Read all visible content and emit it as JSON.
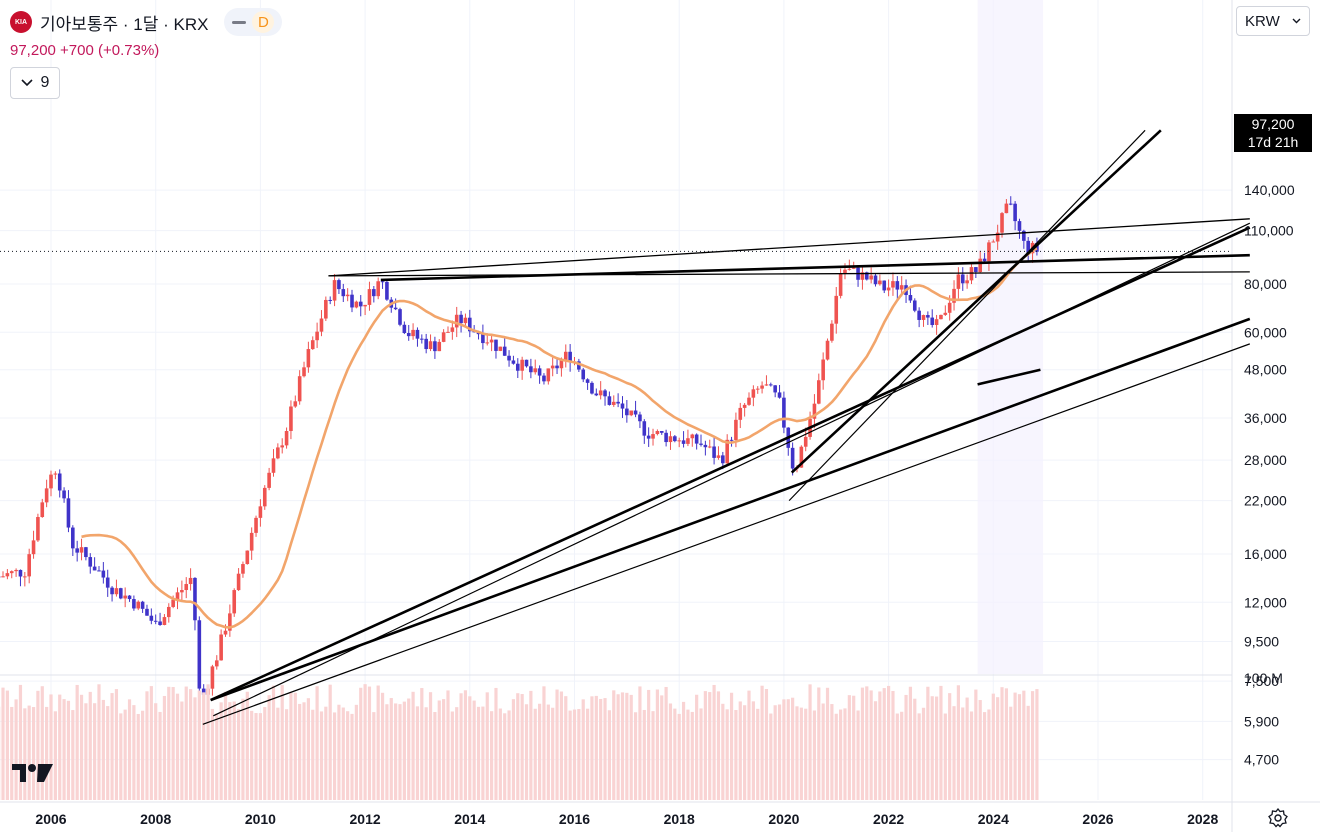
{
  "header": {
    "logo_text": "KIA",
    "symbol": "기아보통주 · 1달 · KRX",
    "quote": "97,200 +700 (+0.73%)",
    "collapse_count": "9",
    "currency": "KRW"
  },
  "price_tag": {
    "price": "97,200",
    "countdown": "17d 21h"
  },
  "colors": {
    "up": "#ef5350",
    "down": "#3f33c9",
    "ma": "#f2a56b",
    "volume": "#f9d3d3",
    "trendline": "#000000"
  },
  "icons": [
    "chevron-down-icon",
    "tradingview-logo-icon",
    "settings-icon"
  ],
  "chart_data": {
    "type": "candlestick",
    "title": "기아보통주 · 1달 · KRX",
    "scale": "log",
    "y_ticks": [
      "140,000",
      "110,000",
      "80,000",
      "60,000",
      "48,000",
      "36,000",
      "28,000",
      "22,000",
      "16,000",
      "12,000",
      "9,500",
      "7,500",
      "5,900",
      "4,700"
    ],
    "y_tick_values": [
      140000,
      110000,
      80000,
      60000,
      48000,
      36000,
      28000,
      22000,
      16000,
      12000,
      9500,
      7500,
      5900,
      4700
    ],
    "x_ticks": [
      "2006",
      "2008",
      "2010",
      "2012",
      "2014",
      "2016",
      "2018",
      "2020",
      "2022",
      "2024",
      "2026",
      "2028"
    ],
    "volume_label": "100 M",
    "last_price": 97200,
    "moving_average": "orange line",
    "series": [
      {
        "t": 2005.0,
        "p": 14000
      },
      {
        "t": 2005.5,
        "p": 14500
      },
      {
        "t": 2005.9,
        "p": 24000
      },
      {
        "t": 2006.1,
        "p": 27000
      },
      {
        "t": 2006.4,
        "p": 17000
      },
      {
        "t": 2006.8,
        "p": 15000
      },
      {
        "t": 2007.2,
        "p": 13000
      },
      {
        "t": 2007.6,
        "p": 12000
      },
      {
        "t": 2008.0,
        "p": 10500
      },
      {
        "t": 2008.3,
        "p": 12000
      },
      {
        "t": 2008.7,
        "p": 14000
      },
      {
        "t": 2008.85,
        "p": 6500
      },
      {
        "t": 2009.2,
        "p": 9000
      },
      {
        "t": 2009.6,
        "p": 14000
      },
      {
        "t": 2010.0,
        "p": 22000
      },
      {
        "t": 2010.5,
        "p": 34000
      },
      {
        "t": 2010.9,
        "p": 52000
      },
      {
        "t": 2011.4,
        "p": 80000
      },
      {
        "t": 2011.9,
        "p": 70000
      },
      {
        "t": 2012.3,
        "p": 82000
      },
      {
        "t": 2012.8,
        "p": 60000
      },
      {
        "t": 2013.3,
        "p": 55000
      },
      {
        "t": 2013.8,
        "p": 65000
      },
      {
        "t": 2014.4,
        "p": 57000
      },
      {
        "t": 2014.9,
        "p": 50000
      },
      {
        "t": 2015.4,
        "p": 45000
      },
      {
        "t": 2015.9,
        "p": 53000
      },
      {
        "t": 2016.4,
        "p": 42000
      },
      {
        "t": 2016.9,
        "p": 38000
      },
      {
        "t": 2017.4,
        "p": 33000
      },
      {
        "t": 2017.9,
        "p": 32000
      },
      {
        "t": 2018.4,
        "p": 31000
      },
      {
        "t": 2018.8,
        "p": 28000
      },
      {
        "t": 2019.2,
        "p": 38000
      },
      {
        "t": 2019.6,
        "p": 44000
      },
      {
        "t": 2019.9,
        "p": 40000
      },
      {
        "t": 2020.2,
        "p": 26000
      },
      {
        "t": 2020.6,
        "p": 40000
      },
      {
        "t": 2020.9,
        "p": 63000
      },
      {
        "t": 2021.1,
        "p": 88000
      },
      {
        "t": 2021.5,
        "p": 84000
      },
      {
        "t": 2021.9,
        "p": 78000
      },
      {
        "t": 2022.3,
        "p": 80000
      },
      {
        "t": 2022.7,
        "p": 63000
      },
      {
        "t": 2022.95,
        "p": 62000
      },
      {
        "t": 2023.3,
        "p": 82000
      },
      {
        "t": 2023.7,
        "p": 87000
      },
      {
        "t": 2024.0,
        "p": 105000
      },
      {
        "t": 2024.3,
        "p": 128000
      },
      {
        "t": 2024.6,
        "p": 100000
      },
      {
        "t": 2024.9,
        "p": 97200
      }
    ]
  }
}
